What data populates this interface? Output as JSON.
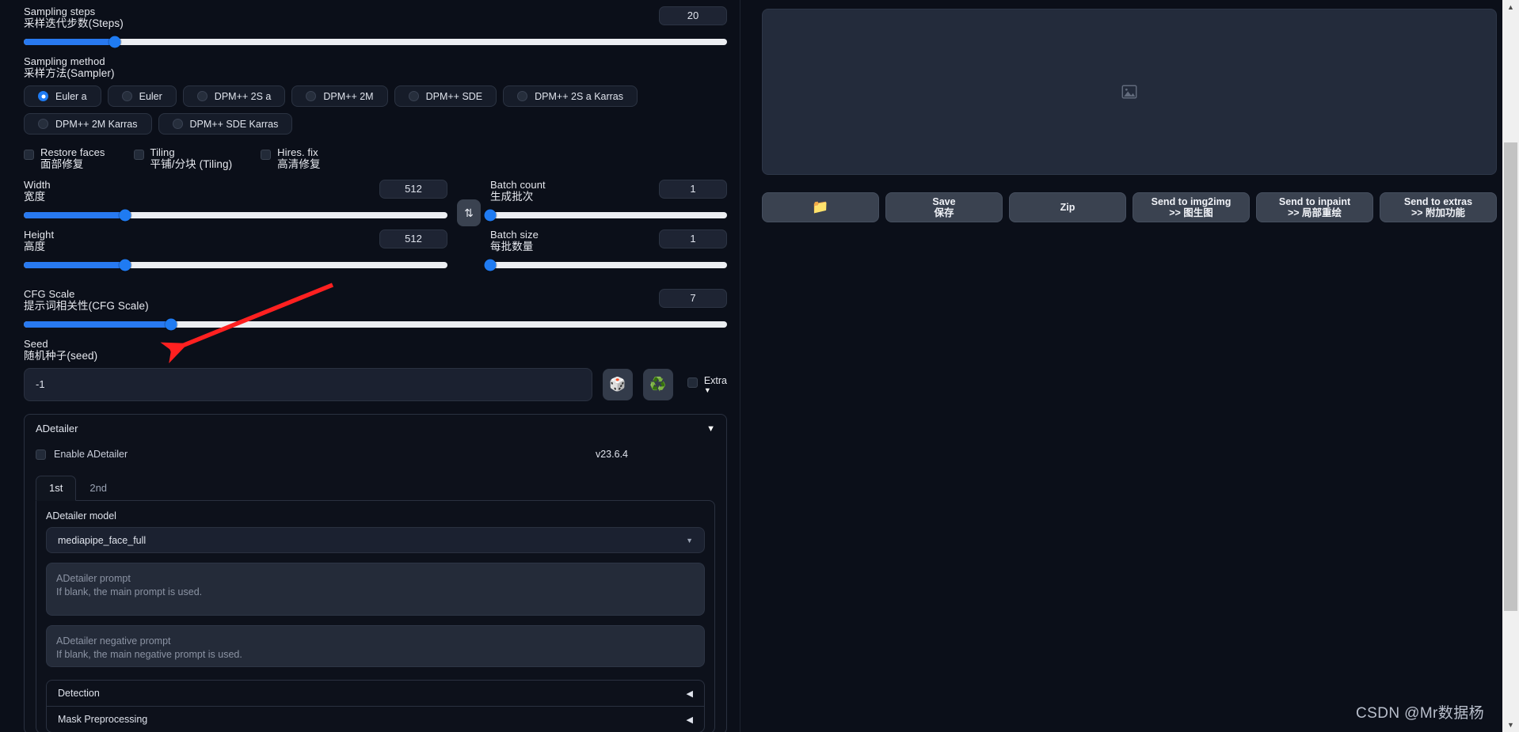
{
  "sampling": {
    "steps": {
      "label_en": "Sampling steps",
      "label_cn": "采样迭代步数(Steps)",
      "value": "20",
      "fill_pct": 13,
      "knob_pct": 13
    },
    "method": {
      "label_en": "Sampling method",
      "label_cn": "采样方法(Sampler)",
      "selected": "Euler a",
      "options": [
        "Euler a",
        "Euler",
        "DPM++ 2S a",
        "DPM++ 2M",
        "DPM++ SDE",
        "DPM++ 2S a Karras",
        "DPM++ 2M Karras",
        "DPM++ SDE Karras"
      ]
    }
  },
  "toggles": [
    {
      "label_en": "Restore faces",
      "label_cn": "面部修复",
      "checked": false
    },
    {
      "label_en": "Tiling",
      "label_cn": "平铺/分块 (Tiling)",
      "checked": false
    },
    {
      "label_en": "Hires. fix",
      "label_cn": "高清修复",
      "checked": false
    }
  ],
  "size": {
    "width": {
      "label_en": "Width",
      "label_cn": "宽度",
      "value": "512",
      "fill_pct": 24
    },
    "height": {
      "label_en": "Height",
      "label_cn": "高度",
      "value": "512",
      "fill_pct": 24
    },
    "swap_icon": "swap-vertical-icon",
    "batch_count": {
      "label_en": "Batch count",
      "label_cn": "生成批次",
      "value": "1",
      "fill_pct": 0
    },
    "batch_size": {
      "label_en": "Batch size",
      "label_cn": "每批数量",
      "value": "1",
      "fill_pct": 0
    }
  },
  "cfg": {
    "label_en": "CFG Scale",
    "label_cn": "提示词相关性(CFG Scale)",
    "value": "7",
    "fill_pct": 21
  },
  "seed": {
    "label_en": "Seed",
    "label_cn": "随机种子(seed)",
    "value": "-1",
    "dice_icon": "🎲",
    "recycle_icon": "♻️",
    "extra_label": "Extra",
    "extra_checked": false,
    "caret": "▼"
  },
  "adetailer": {
    "title": "ADetailer",
    "collapse_caret": "▼",
    "enable_label": "Enable ADetailer",
    "enable_checked": false,
    "version": "v23.6.4",
    "tabs": [
      {
        "label": "1st",
        "active": true
      },
      {
        "label": "2nd",
        "active": false
      }
    ],
    "model_label": "ADetailer model",
    "model_value": "mediapipe_face_full",
    "model_caret": "▼",
    "prompt_placeholder": "ADetailer prompt\nIf blank, the main prompt is used.",
    "negative_placeholder": "ADetailer negative prompt\nIf blank, the main negative prompt is used.",
    "sections": [
      {
        "label": "Detection",
        "caret": "◀"
      },
      {
        "label": "Mask Preprocessing",
        "caret": "◀"
      }
    ]
  },
  "output": {
    "placeholder_icon": "image-placeholder-icon",
    "buttons": [
      {
        "name": "open-folder",
        "icon": "📁",
        "label_en": "",
        "label_cn": ""
      },
      {
        "name": "save",
        "icon": "",
        "label_en": "Save",
        "label_cn": "保存"
      },
      {
        "name": "zip",
        "icon": "",
        "label_en": "Zip",
        "label_cn": ""
      },
      {
        "name": "send-to-img2img",
        "icon": "",
        "label_en": "Send to img2img",
        "label_cn": ">> 图生图"
      },
      {
        "name": "send-to-inpaint",
        "icon": "",
        "label_en": "Send to inpaint",
        "label_cn": ">> 局部重绘"
      },
      {
        "name": "send-to-extras",
        "icon": "",
        "label_en": "Send to extras",
        "label_cn": ">> 附加功能"
      }
    ]
  },
  "annotation": {
    "arrow_color": "#ff2020"
  },
  "watermark": {
    "text": "CSDN @Mr数据杨"
  },
  "scrollbar": {
    "up_caret": "▲",
    "down_caret": "▼"
  },
  "colors": {
    "accent": "#1f7bf2",
    "panel": "#0b0f19",
    "button": "#3a4250",
    "arrow": "#ff2020"
  }
}
